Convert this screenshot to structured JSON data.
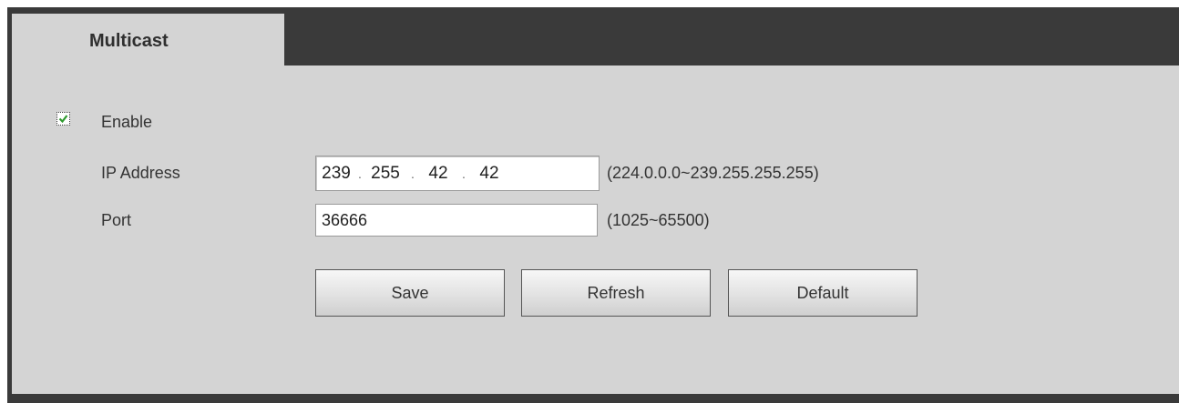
{
  "tab": {
    "label": "Multicast"
  },
  "form": {
    "enable": {
      "label": "Enable",
      "checked": true
    },
    "ip_address": {
      "label": "IP Address",
      "octets": [
        "239",
        "255",
        "42",
        "42"
      ],
      "separator": ".",
      "range_hint": "(224.0.0.0~239.255.255.255)"
    },
    "port": {
      "label": "Port",
      "value": "36666",
      "range_hint": "(1025~65500)"
    }
  },
  "buttons": {
    "save": "Save",
    "refresh": "Refresh",
    "default": "Default"
  },
  "icons": {
    "checkbox": "check-icon"
  },
  "colors": {
    "panel": "#d4d4d4",
    "frame": "#3a3a3a",
    "check": "#2e9a2e"
  }
}
